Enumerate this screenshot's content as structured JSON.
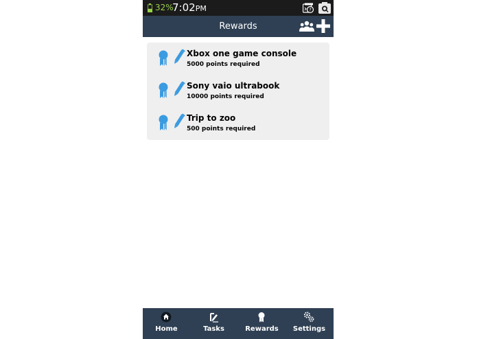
{
  "status_bar": {
    "battery": "32%",
    "time": "7:02",
    "ampm": "PM",
    "icons": [
      "battery-icon",
      "screenshot-icon",
      "camera-search-icon"
    ]
  },
  "header": {
    "title": "Rewards",
    "icons": [
      "group-icon",
      "add-icon"
    ]
  },
  "rewards": [
    {
      "title": "Xbox one game console",
      "points": "5000 points required"
    },
    {
      "title": "Sony vaio ultrabook",
      "points": "10000 points required"
    },
    {
      "title": "Trip to zoo",
      "points": "500 points required"
    }
  ],
  "row_icons": [
    "award-icon",
    "pencil-icon"
  ],
  "bottom_nav": [
    {
      "label": "Home",
      "icon": "home-icon"
    },
    {
      "label": "Tasks",
      "icon": "tasks-icon"
    },
    {
      "label": "Rewards",
      "icon": "rewards-icon"
    },
    {
      "label": "Settings",
      "icon": "settings-icon"
    }
  ],
  "colors": {
    "status_bar": "#1b1b1b",
    "header": "#2f4054",
    "card": "#efefef",
    "accent": "#3b9be0",
    "battery": "#9ad14b"
  }
}
